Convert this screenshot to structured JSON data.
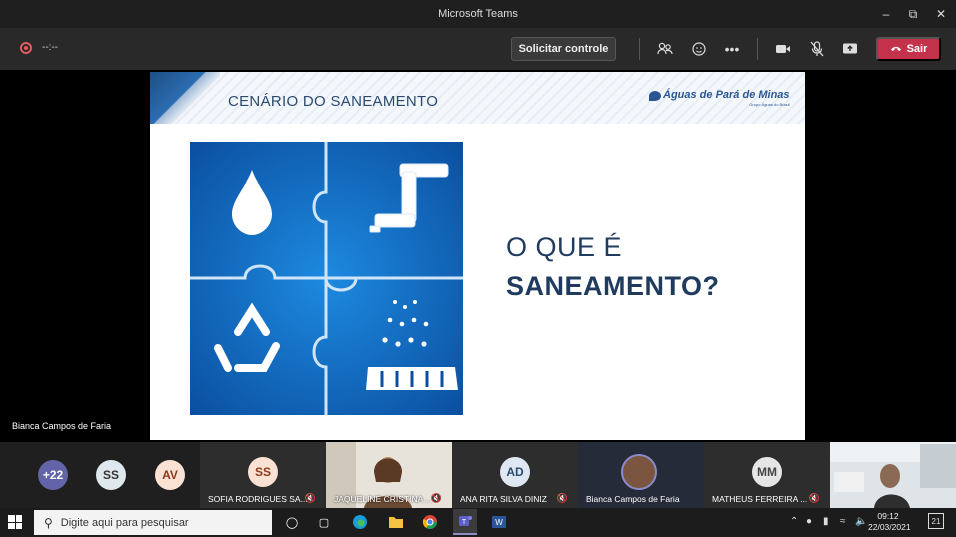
{
  "window": {
    "title": "Microsoft Teams"
  },
  "toolbar": {
    "timer": "--:--",
    "request_control_label": "Solicitar controle",
    "leave_label": "Sair"
  },
  "slide": {
    "section_title": "CENÁRIO DO SANEAMENTO",
    "logo_text": "Águas de Pará de Minas",
    "logo_sub": "Grupo Águas do Brasil",
    "question_line1": "O QUE É",
    "question_line2": "SANEAMENTO?"
  },
  "presenter": {
    "name": "Bianca Campos de Faria"
  },
  "participants": {
    "small_avatars": [
      {
        "initials": "+22",
        "color": "#6264a7"
      },
      {
        "initials": "SS",
        "color": "#dfe8ec"
      },
      {
        "initials": "AV",
        "color": "#f9e2d3"
      }
    ],
    "tiles": [
      {
        "initials": "SS",
        "name": "SOFIA RODRIGUES SA...",
        "avatar_color": "#f9e2d3"
      },
      {
        "initials": "",
        "name": "JAQUELINE CRISTINA ...",
        "avatar_color": ""
      },
      {
        "initials": "AD",
        "name": "ANA RITA SILVA DINIZ",
        "avatar_color": "#dfe8f2"
      },
      {
        "initials": "",
        "name": "Bianca Campos de Faria",
        "avatar_color": ""
      },
      {
        "initials": "MM",
        "name": "MATHEUS FERREIRA ...",
        "avatar_color": "#e6e6e6"
      }
    ]
  },
  "taskbar": {
    "search_placeholder": "Digite aqui para pesquisar",
    "time": "09:12",
    "date": "22/03/2021",
    "notification_count": "21"
  }
}
